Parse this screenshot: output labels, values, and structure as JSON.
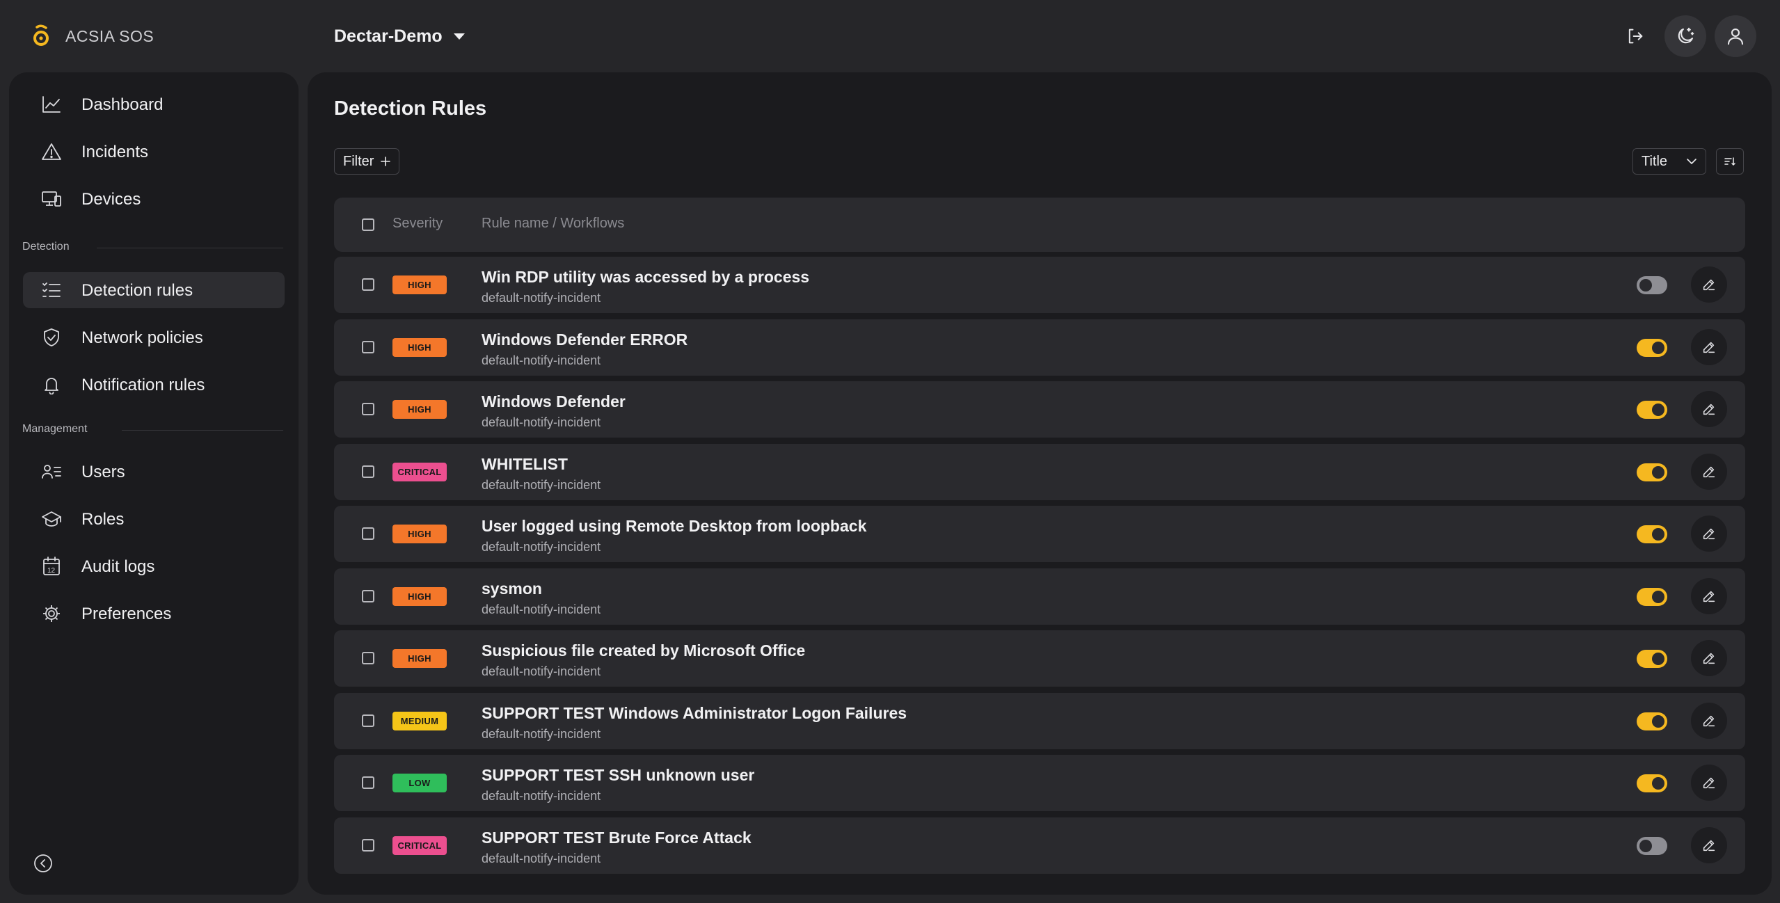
{
  "app": {
    "brand": "ACSIA SOS",
    "organization": "Dectar-Demo"
  },
  "colors": {
    "accent": "#f5b820",
    "severity": {
      "HIGH": "#f4772a",
      "CRITICAL": "#ec4f8f",
      "MEDIUM": "#f5c518",
      "LOW": "#2fbe5b"
    }
  },
  "sidebar": {
    "items": [
      {
        "id": "dashboard",
        "label": "Dashboard",
        "icon": "chart-line-icon"
      },
      {
        "id": "incidents",
        "label": "Incidents",
        "icon": "warning-triangle-icon"
      },
      {
        "id": "devices",
        "label": "Devices",
        "icon": "devices-icon"
      }
    ],
    "detection_label": "Detection",
    "detection_items": [
      {
        "id": "detection-rules",
        "label": "Detection rules",
        "icon": "checklist-icon",
        "active": true
      },
      {
        "id": "network-policies",
        "label": "Network policies",
        "icon": "shield-check-icon"
      },
      {
        "id": "notification-rules",
        "label": "Notification rules",
        "icon": "bell-icon"
      }
    ],
    "management_label": "Management",
    "management_items": [
      {
        "id": "users",
        "label": "Users",
        "icon": "users-list-icon"
      },
      {
        "id": "roles",
        "label": "Roles",
        "icon": "graduation-cap-icon"
      },
      {
        "id": "audit-logs",
        "label": "Audit logs",
        "icon": "calendar-icon"
      },
      {
        "id": "preferences",
        "label": "Preferences",
        "icon": "gear-icon"
      }
    ]
  },
  "main": {
    "title": "Detection Rules",
    "filter_label": "Filter",
    "sort_label": "Title",
    "columns": {
      "severity": "Severity",
      "rule": "Rule name / Workflows"
    },
    "rules": [
      {
        "severity": "HIGH",
        "title": "Win RDP utility was accessed by a process",
        "workflow": "default-notify-incident",
        "enabled": false
      },
      {
        "severity": "HIGH",
        "title": "Windows Defender ERROR",
        "workflow": "default-notify-incident",
        "enabled": true
      },
      {
        "severity": "HIGH",
        "title": "Windows Defender",
        "workflow": "default-notify-incident",
        "enabled": true
      },
      {
        "severity": "CRITICAL",
        "title": "WHITELIST",
        "workflow": "default-notify-incident",
        "enabled": true
      },
      {
        "severity": "HIGH",
        "title": "User logged using Remote Desktop from loopback",
        "workflow": "default-notify-incident",
        "enabled": true
      },
      {
        "severity": "HIGH",
        "title": "sysmon",
        "workflow": "default-notify-incident",
        "enabled": true
      },
      {
        "severity": "HIGH",
        "title": "Suspicious file created by Microsoft Office",
        "workflow": "default-notify-incident",
        "enabled": true
      },
      {
        "severity": "MEDIUM",
        "title": "SUPPORT TEST Windows Administrator Logon Failures",
        "workflow": "default-notify-incident",
        "enabled": true
      },
      {
        "severity": "LOW",
        "title": "SUPPORT TEST SSH unknown user",
        "workflow": "default-notify-incident",
        "enabled": true
      },
      {
        "severity": "CRITICAL",
        "title": "SUPPORT TEST Brute Force Attack",
        "workflow": "default-notify-incident",
        "enabled": false
      }
    ]
  }
}
